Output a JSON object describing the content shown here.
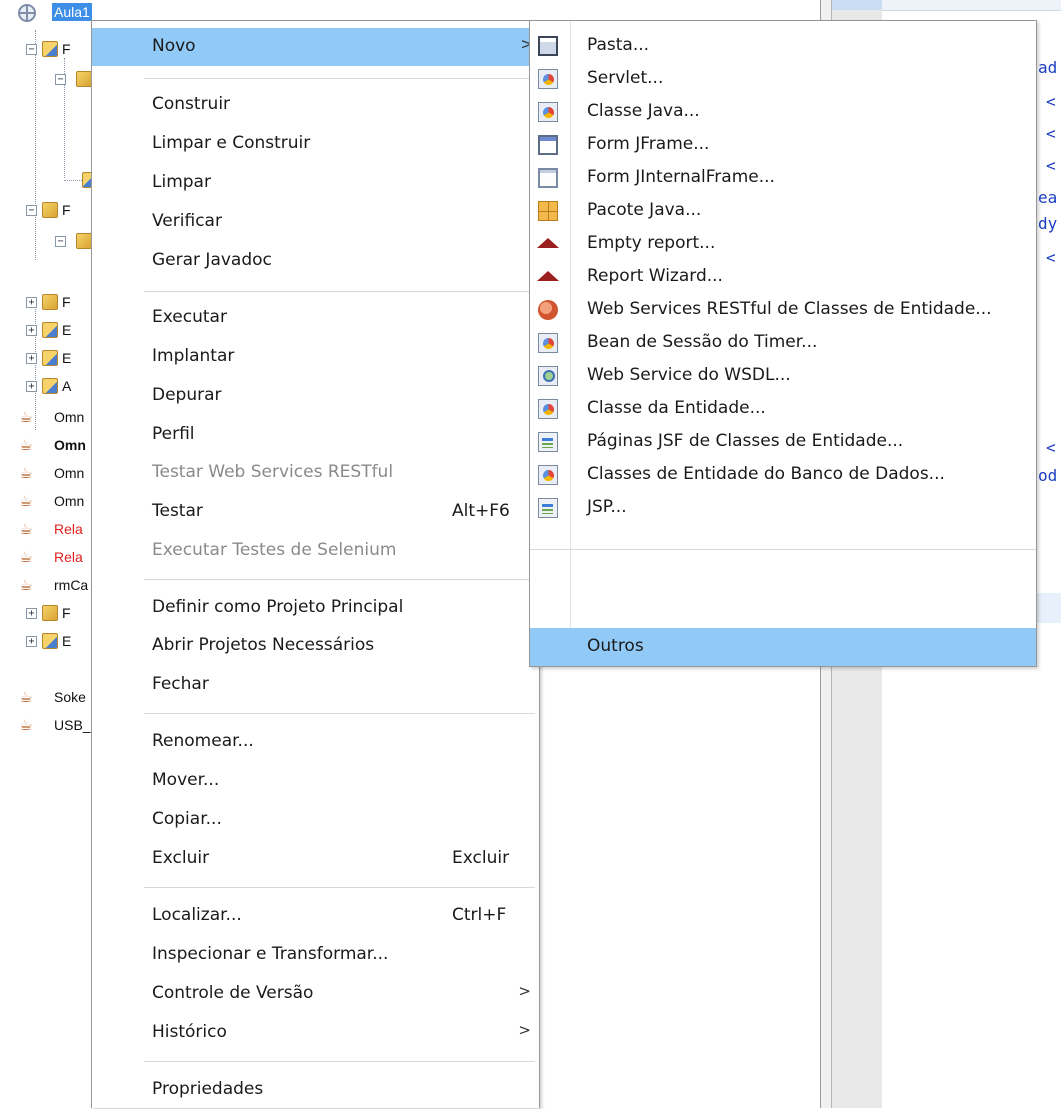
{
  "project_tree": {
    "selected_project": "Aula1",
    "rows": [
      {
        "label": "Omn",
        "style": "normal"
      },
      {
        "label": "Omn",
        "style": "bold"
      },
      {
        "label": "Omn",
        "style": "normal"
      },
      {
        "label": "Omn",
        "style": "normal"
      },
      {
        "label": "Rela",
        "style": "error"
      },
      {
        "label": "Rela",
        "style": "error"
      },
      {
        "label": "rmCa",
        "style": "normal"
      },
      {
        "label": "Soke",
        "style": "normal"
      },
      {
        "label": "USB_",
        "style": "normal"
      }
    ],
    "folder_letters": [
      "F",
      "F",
      "F",
      "E",
      "E",
      "A",
      "F",
      "E"
    ]
  },
  "editor": {
    "code_fragments": [
      "ad",
      "<",
      "<",
      "<",
      "ea",
      "dy",
      "<",
      "<",
      "od"
    ]
  },
  "context_menu": {
    "items": [
      {
        "label": "Novo",
        "has_submenu": true,
        "highlighted": true
      },
      {
        "label": "Construir"
      },
      {
        "label": "Limpar e Construir"
      },
      {
        "label": "Limpar"
      },
      {
        "label": "Verificar"
      },
      {
        "label": "Gerar Javadoc"
      },
      {
        "label": "Executar"
      },
      {
        "label": "Implantar"
      },
      {
        "label": "Depurar"
      },
      {
        "label": "Perfil"
      },
      {
        "label": "Testar Web Services RESTful",
        "disabled": true
      },
      {
        "label": "Testar",
        "shortcut": "Alt+F6"
      },
      {
        "label": "Executar Testes de Selenium",
        "disabled": true
      },
      {
        "label": "Definir como Projeto Principal"
      },
      {
        "label": "Abrir Projetos Necessários",
        "has_submenu": true
      },
      {
        "label": "Fechar"
      },
      {
        "label": "Renomear..."
      },
      {
        "label": "Mover..."
      },
      {
        "label": "Copiar..."
      },
      {
        "label": "Excluir",
        "shortcut": "Excluir"
      },
      {
        "label": "Localizar...",
        "shortcut": "Ctrl+F"
      },
      {
        "label": "Inspecionar e Transformar..."
      },
      {
        "label": "Controle de Versão",
        "has_submenu": true
      },
      {
        "label": "Histórico",
        "has_submenu": true
      },
      {
        "label": "Propriedades"
      }
    ],
    "submenu_arrow": ">"
  },
  "new_submenu": {
    "items": [
      {
        "label": "Pasta...",
        "icon": "folder-icon"
      },
      {
        "label": "Servlet...",
        "icon": "servlet-icon"
      },
      {
        "label": "Classe Java...",
        "icon": "java-class-icon"
      },
      {
        "label": "Form JFrame...",
        "icon": "jframe-icon"
      },
      {
        "label": "Form JInternalFrame...",
        "icon": "jinternalframe-icon"
      },
      {
        "label": "Pacote Java...",
        "icon": "java-package-icon"
      },
      {
        "label": "Empty report...",
        "icon": "report-icon"
      },
      {
        "label": "Report Wizard...",
        "icon": "report-icon"
      },
      {
        "label": "Web Services RESTful de Classes de Entidade...",
        "icon": "restful-service-icon"
      },
      {
        "label": "Bean de Sessão do Timer...",
        "icon": "session-bean-icon"
      },
      {
        "label": "Web Service do WSDL...",
        "icon": "wsdl-icon"
      },
      {
        "label": "Classe da Entidade...",
        "icon": "entity-class-icon"
      },
      {
        "label": "Páginas JSF de Classes de Entidade...",
        "icon": "jsf-page-icon"
      },
      {
        "label": "Classes de Entidade do Banco de Dados...",
        "icon": "entity-class-icon"
      },
      {
        "label": "JSP...",
        "icon": "jsp-icon"
      },
      {
        "label": "Outros",
        "highlighted": true
      }
    ]
  }
}
